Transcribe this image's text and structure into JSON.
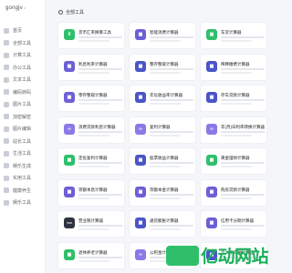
{
  "logo": {
    "text": "gongjv",
    "mark": "z"
  },
  "sidebar": {
    "items": [
      {
        "label": "首页"
      },
      {
        "label": "全部工具"
      },
      {
        "label": "计算工具"
      },
      {
        "label": "办公工具"
      },
      {
        "label": "文本工具"
      },
      {
        "label": "编码转码"
      },
      {
        "label": "图片工具"
      },
      {
        "label": "加密解密"
      },
      {
        "label": "图片编辑"
      },
      {
        "label": "站长工具"
      },
      {
        "label": "生活工具"
      },
      {
        "label": "娱乐生成"
      },
      {
        "label": "实用工具"
      },
      {
        "label": "健康养生"
      },
      {
        "label": "娱乐工具"
      }
    ]
  },
  "section": {
    "title": "全部工具"
  },
  "cards": [
    {
      "title": "货币汇率换算工具",
      "icon": "yen-icon",
      "color": "#2fbf6b"
    },
    {
      "title": "智能消费计算器",
      "icon": "calc-icon",
      "color": "#6d5fd6"
    },
    {
      "title": "车贷计算器",
      "icon": "car-icon",
      "color": "#2fbf6b"
    },
    {
      "title": "利息利率计算器",
      "icon": "calc-icon",
      "color": "#6d5fd6"
    },
    {
      "title": "整存整取计算器",
      "icon": "calc-icon",
      "color": "#4a55c8"
    },
    {
      "title": "稀释缴费计算器",
      "icon": "calc-icon",
      "color": "#4a55c8"
    },
    {
      "title": "零存整取计算器",
      "icon": "calc-icon",
      "color": "#6d5fd6"
    },
    {
      "title": "年化收益率计算器",
      "icon": "calc-icon",
      "color": "#4a55c8"
    },
    {
      "title": "存车贷款计算器",
      "icon": "calc-icon",
      "color": "#4a55c8"
    },
    {
      "title": "消费贷款利息计算器",
      "icon": "link-icon",
      "color": "#8a7ae6"
    },
    {
      "title": "复利计算器",
      "icon": "link-icon",
      "color": "#8a7ae6"
    },
    {
      "title": "年(月)日利率转换计算器",
      "icon": "link-icon",
      "color": "#8a7ae6"
    },
    {
      "title": "定投复利计算器",
      "icon": "calc-icon",
      "color": "#2fbf6b"
    },
    {
      "title": "股票收益计算器",
      "icon": "calc-icon",
      "color": "#4a55c8"
    },
    {
      "title": "黄金理财计算器",
      "icon": "calc-icon",
      "color": "#2fbf6b"
    },
    {
      "title": "等额本息计算器",
      "icon": "calc-icon",
      "color": "#6d5fd6"
    },
    {
      "title": "等额本金计算器",
      "icon": "calc-icon",
      "color": "#6d5fd6"
    },
    {
      "title": "购房贷款计算器",
      "icon": "calc-icon",
      "color": "#6d5fd6"
    },
    {
      "title": "营业税计算器",
      "icon": "tax-icon",
      "color": "#2f3340"
    },
    {
      "title": "通货膨胀计算器",
      "icon": "calc-icon",
      "color": "#4a55c8"
    },
    {
      "title": "信用卡分期计算器",
      "icon": "calc-icon",
      "color": "#6d5fd6"
    },
    {
      "title": "退休养老计算器",
      "icon": "calc-icon",
      "color": "#2fbf6b"
    },
    {
      "title": "公积金计算器",
      "icon": "link-icon",
      "color": "#8a7ae6"
    },
    {
      "title": "个人所得税计算器",
      "icon": "calc-icon",
      "color": "#4a55c8"
    }
  ],
  "watermark": {
    "text": "亿动网站"
  }
}
